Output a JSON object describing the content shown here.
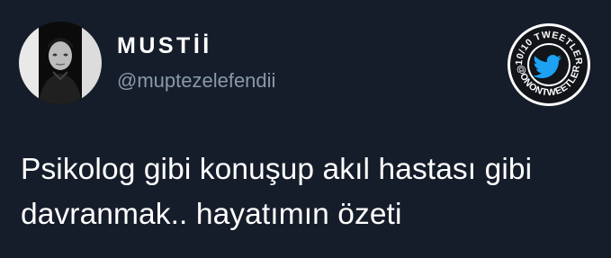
{
  "author": {
    "display_name": "MUSTİİ",
    "handle": "@muptezelefendii"
  },
  "tweet": {
    "lines": [
      "Psikolog gibi konuşup akıl hastası gibi",
      "davranmak.. hayatımın özeti"
    ]
  },
  "badge": {
    "top_text": "10/10 TWEETLER",
    "bottom_text": "@ONONTWEETLER",
    "icon": "twitter-bird-icon",
    "colors": {
      "ring": "#ffffff",
      "fill": "#111418",
      "bird": "#1da1f2"
    }
  },
  "colors": {
    "background": "#161d2a",
    "text": "#ffffff",
    "secondary_text": "#8899a6"
  }
}
